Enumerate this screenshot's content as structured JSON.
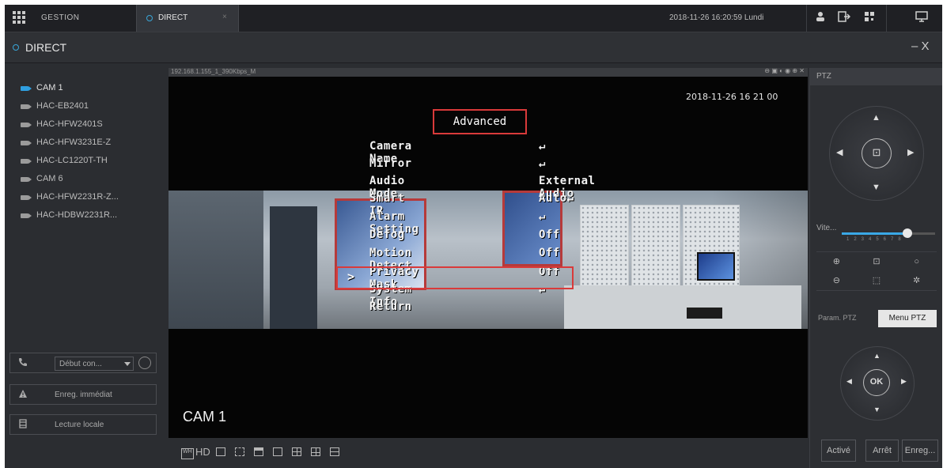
{
  "topbar": {
    "gestion_label": "GESTION",
    "direct_tab_label": "DIRECT",
    "direct_tab_close": "×",
    "datetime": "2018-11-26 16:20:59 Lundi"
  },
  "header": {
    "title": "DIRECT",
    "minimize": "–",
    "close": "X"
  },
  "cameras": [
    {
      "label": "CAM 1",
      "active": true
    },
    {
      "label": "HAC-EB2401"
    },
    {
      "label": "HAC-HFW2401S"
    },
    {
      "label": "HAC-HFW3231E-Z"
    },
    {
      "label": "HAC-LC1220T-TH"
    },
    {
      "label": "CAM 6"
    },
    {
      "label": "HAC-HFW2231R-Z..."
    },
    {
      "label": "HAC-HDBW2231R..."
    }
  ],
  "left_actions": {
    "talk_select": "Début con...",
    "record": "Enreg. immédiat",
    "playback": "Lecture locale"
  },
  "video": {
    "stream_info": "192.168.1.155_1_390Kbps_M",
    "osd_title": "Advanced",
    "osd_date": "2018-11-26 16 21 00",
    "camera_label": "CAM 1",
    "cursor": ">",
    "menu": [
      {
        "key": "Camera Name",
        "value": "↵"
      },
      {
        "key": "Mirror",
        "value": "↵"
      },
      {
        "key": "Audio Mode",
        "value": "External Audio"
      },
      {
        "key": "Smart IR",
        "value": "Auto↵"
      },
      {
        "key": "Alarm Setting",
        "value": "↵"
      },
      {
        "key": "Defog",
        "value": "Off"
      },
      {
        "key": "Motion Detect",
        "value": "Off"
      },
      {
        "key": "Privacy Mask",
        "value": "Off"
      },
      {
        "key": "System Info",
        "value": "↵"
      },
      {
        "key": "Return",
        "value": ""
      }
    ]
  },
  "bottom_toolbar": {
    "wh": "WH",
    "hd": "HD"
  },
  "ptz": {
    "title": "PTZ",
    "vite_label": "Vite...",
    "speed_level": 0.7,
    "tab_param": "Param. PTZ",
    "tab_menu": "Menu PTZ",
    "ok": "OK",
    "btn_active": "Activé",
    "btn_stop": "Arrêt",
    "btn_record": "Enreg..."
  },
  "colors": {
    "accent": "#3aa8e6",
    "highlight_box": "#d93a3a"
  }
}
